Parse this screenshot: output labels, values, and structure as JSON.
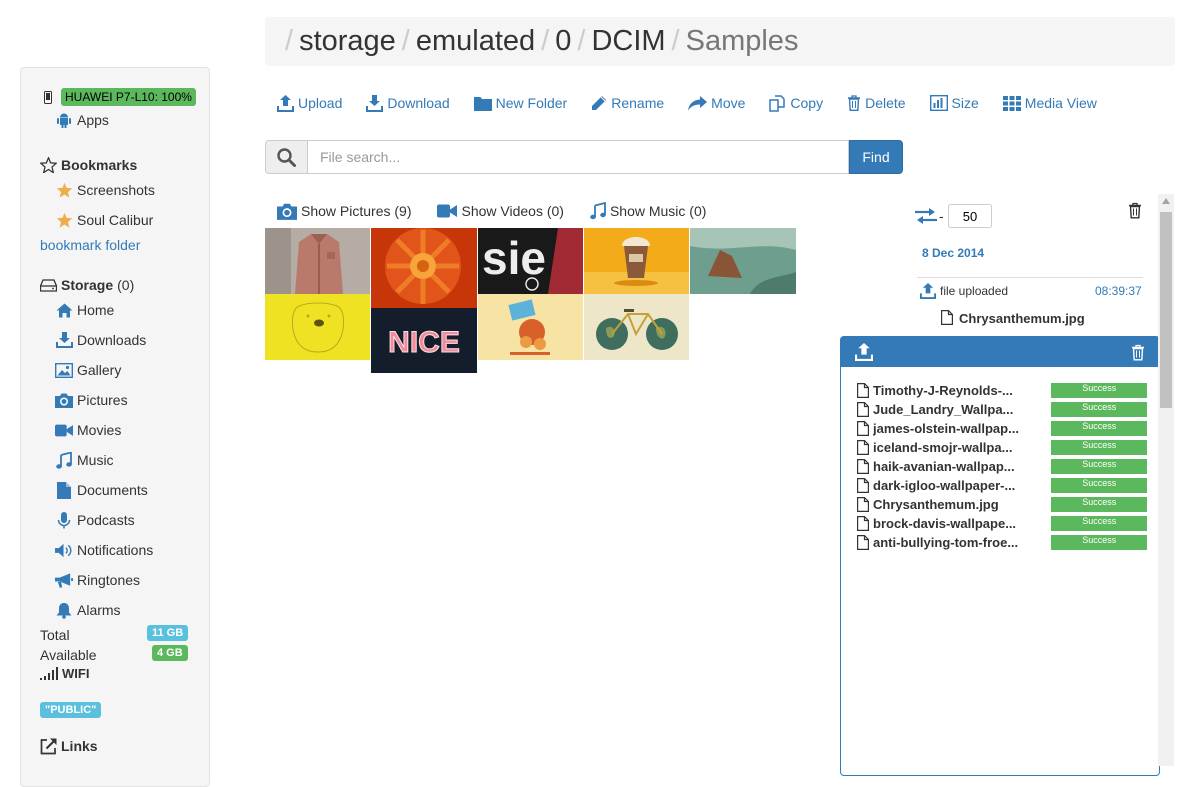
{
  "breadcrumb": {
    "items": [
      "storage",
      "emulated",
      "0",
      "DCIM"
    ],
    "current": "Samples"
  },
  "toolbar": {
    "upload": "Upload",
    "download": "Download",
    "new_folder": "New Folder",
    "rename": "Rename",
    "move": "Move",
    "copy": "Copy",
    "delete": "Delete",
    "size": "Size",
    "media_view": "Media View"
  },
  "search": {
    "placeholder": "File search...",
    "button": "Find"
  },
  "media_tabs": {
    "pictures": "Show Pictures (9)",
    "videos": "Show Videos (0)",
    "music": "Show Music (0)"
  },
  "sidebar": {
    "device": "HUAWEI P7-L10: 100%",
    "apps": "Apps",
    "bookmarks_title": "Bookmarks",
    "bookmarks": [
      "Screenshots",
      "Soul Calibur"
    ],
    "bookmark_folder": "bookmark folder",
    "storage_title": "Storage",
    "storage_count": "(0)",
    "storage_items": {
      "home": "Home",
      "downloads": "Downloads",
      "gallery": "Gallery",
      "pictures": "Pictures",
      "movies": "Movies",
      "music": "Music",
      "documents": "Documents",
      "podcasts": "Podcasts",
      "notifications": "Notifications",
      "ringtones": "Ringtones",
      "alarms": "Alarms"
    },
    "total_label": "Total",
    "total_value": "11 GB",
    "available_label": "Available",
    "available_value": "4 GB",
    "wifi": "WIFI",
    "public_badge": "\"PUBLIC\"",
    "links": "Links"
  },
  "activity": {
    "page_size": "50",
    "dash": "-",
    "date": "8 Dec 2014",
    "event": "file uploaded",
    "time": "08:39:37",
    "file": "Chrysanthemum.jpg"
  },
  "uploads": [
    {
      "name": "Timothy-J-Reynolds-...",
      "status": "Success"
    },
    {
      "name": "Jude_Landry_Wallpa...",
      "status": "Success"
    },
    {
      "name": "james-olstein-wallpap...",
      "status": "Success"
    },
    {
      "name": "iceland-smojr-wallpa...",
      "status": "Success"
    },
    {
      "name": "haik-avanian-wallpap...",
      "status": "Success"
    },
    {
      "name": "dark-igloo-wallpaper-...",
      "status": "Success"
    },
    {
      "name": "Chrysanthemum.jpg",
      "status": "Success"
    },
    {
      "name": "brock-davis-wallpape...",
      "status": "Success"
    },
    {
      "name": "anti-bullying-tom-froe...",
      "status": "Success"
    }
  ],
  "thumbnail_text": {
    "nice": "NICE",
    "sie": "sie"
  },
  "colors": {
    "primary": "#337ab7",
    "success": "#5cb85c",
    "info": "#5bc0de",
    "star": "#f0ad4e"
  }
}
